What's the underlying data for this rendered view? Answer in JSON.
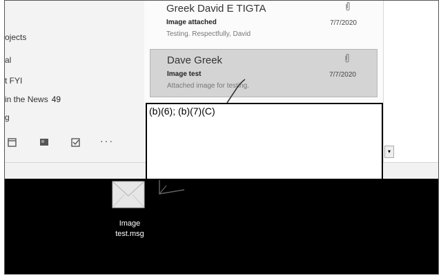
{
  "folders": [
    {
      "label": "ojects",
      "count": ""
    },
    {
      "label": "al",
      "count": ""
    },
    {
      "label": "t FYI",
      "count": ""
    },
    {
      "label": "in the News",
      "count": "49"
    },
    {
      "label": "g",
      "count": ""
    }
  ],
  "nav_icons": [
    "calendar-icon",
    "people-icon",
    "tasks-icon"
  ],
  "nav_more": "···",
  "messages": [
    {
      "sender": "Greek David E TIGTA",
      "subject": "Image attached",
      "preview": "Testing.  Respectfully,  David",
      "date": "7/7/2020",
      "has_attachment": true
    },
    {
      "sender": "Dave Greek",
      "subject": "Image test",
      "preview": "Attached image for testing.",
      "date": "7/7/2020",
      "has_attachment": true
    }
  ],
  "redaction": {
    "label": "(b)(6); (b)(7)(C)"
  },
  "desktop": {
    "file_label_line1": "Image",
    "file_label_line2": "test.msg"
  },
  "colors": {
    "desktop_bg": "#000000",
    "redaction_border": "#000000",
    "selected_row": "#d4d4d4"
  }
}
